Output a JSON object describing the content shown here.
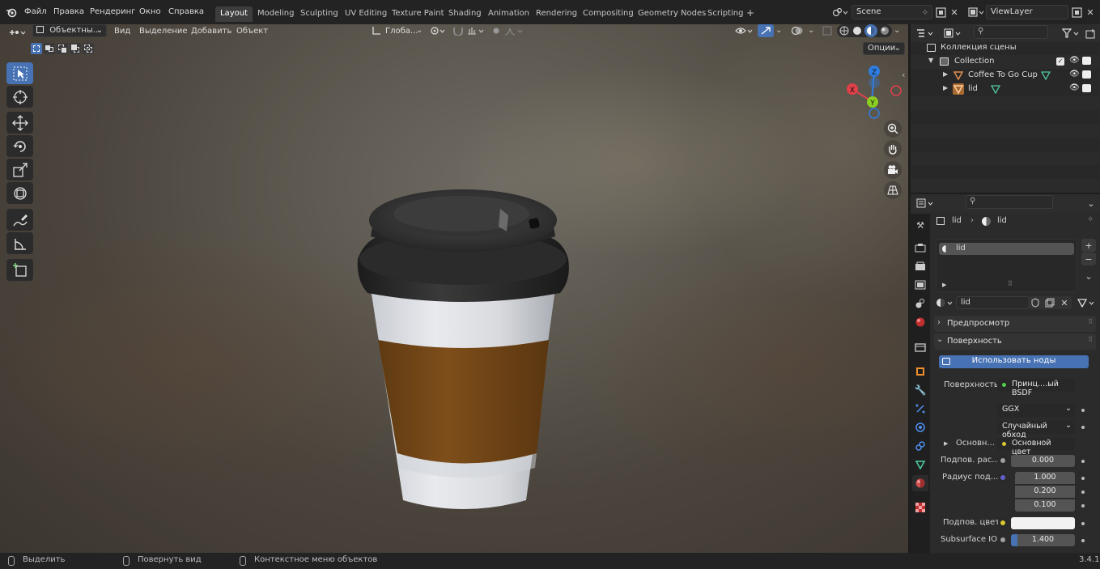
{
  "menu": [
    "Файл",
    "Правка",
    "Рендеринг",
    "Окно",
    "Справка"
  ],
  "workspaces": [
    "Layout",
    "Modeling",
    "Sculpting",
    "UV Editing",
    "Texture Paint",
    "Shading",
    "Animation",
    "Rendering",
    "Compositing",
    "Geometry Nodes",
    "Scripting"
  ],
  "workspace_add": "+",
  "scene": {
    "name": "Scene"
  },
  "view_layer": {
    "name": "ViewLayer"
  },
  "viewport": {
    "mode": "Объектны...",
    "menus": [
      "Вид",
      "Выделение",
      "Добавить",
      "Объект"
    ],
    "transform_orientation": "Глоба...",
    "options_label": "Опции",
    "gizmo": {
      "z": "Z",
      "y": "Y",
      "x": "X"
    }
  },
  "status_bar": {
    "items": [
      "Выделить",
      "Повернуть вид",
      "Контекстное меню объектов"
    ],
    "version": "3.4.1"
  },
  "outliner": {
    "scene_collection": "Коллекция сцены",
    "collection": "Collection",
    "objects": [
      "Coffee To Go Cup",
      "lid"
    ]
  },
  "properties": {
    "breadcrumb_object": "lid",
    "breadcrumb_material": "lid",
    "slot_name": "lid",
    "material_name": "lid",
    "panel_preview": "Предпросмотр",
    "panel_surface": "Поверхность",
    "use_nodes_button": "Использовать ноды",
    "surface_label": "Поверхность",
    "surface_value": "Принц....ый BSDF",
    "distribution": "GGX",
    "subsurface_method": "Случайный обход",
    "base_label": "Основн...",
    "base_value": "Основной цвет",
    "subsurface_label": "Подпов. рас...",
    "subsurface_value": "0.000",
    "radius_label": "Радиус под...",
    "radius_values": [
      "1.000",
      "0.200",
      "0.100"
    ],
    "subsurface_color_label": "Подпов. цвет",
    "ior_label": "Subsurface IOR",
    "ior_value": "1.400"
  },
  "colors": {
    "accent": "#4772b3",
    "axis_x": "#e0404a",
    "axis_y": "#8ccf20",
    "axis_z": "#2f7de1",
    "sleeve": "#7a4a16",
    "lid": "#2a2a2a"
  }
}
